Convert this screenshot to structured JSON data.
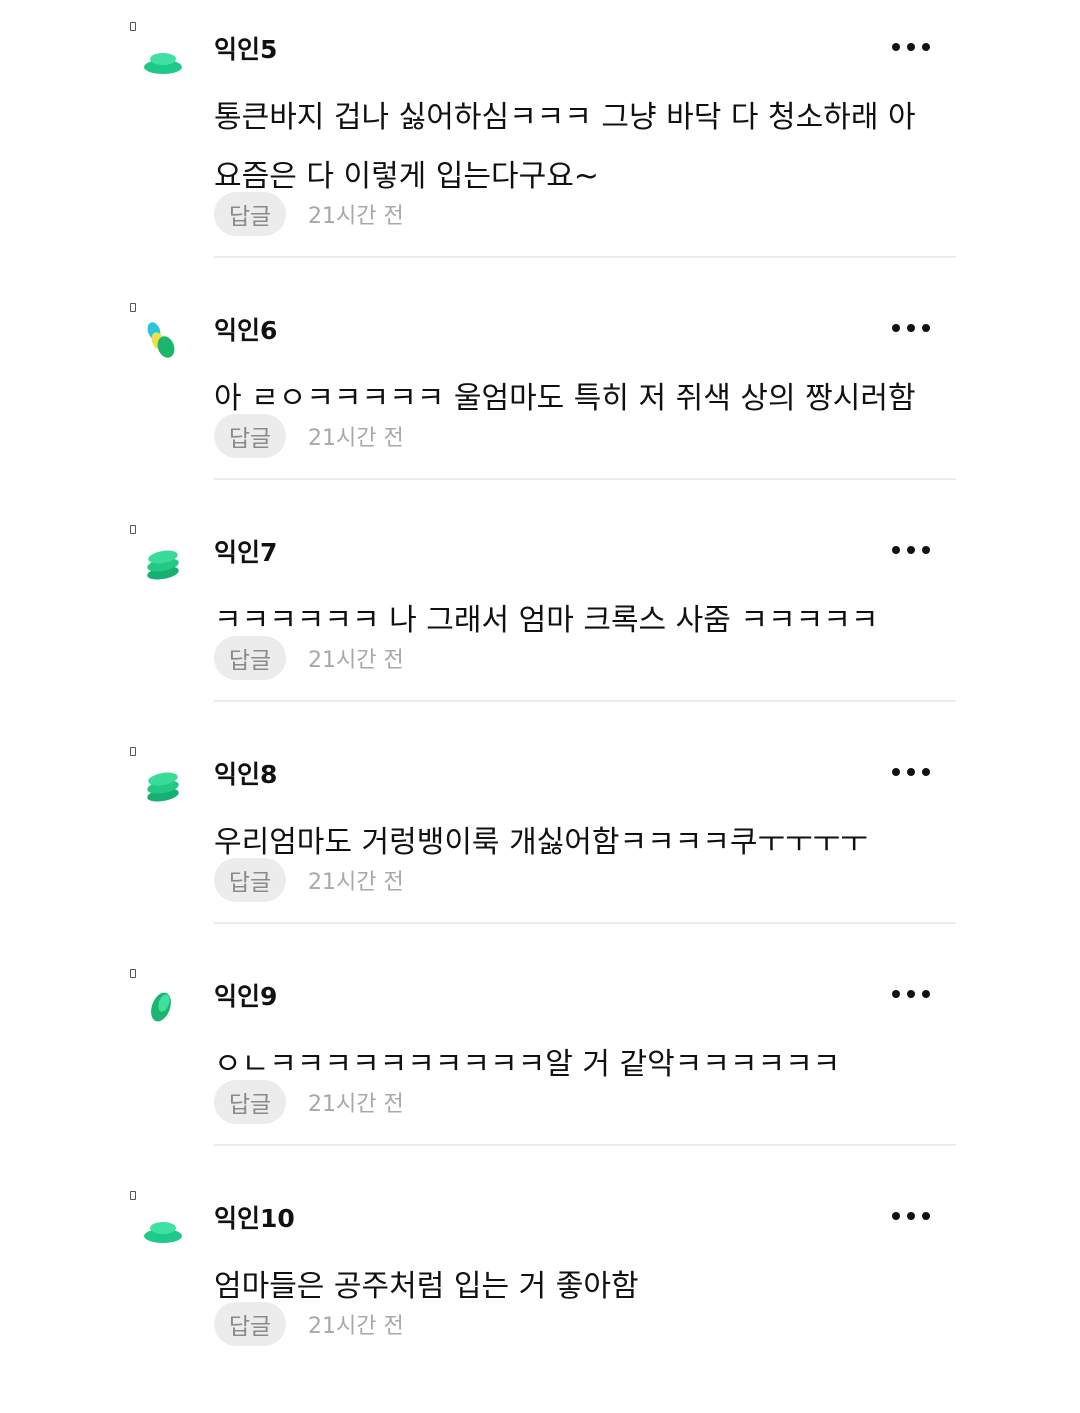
{
  "colors": {
    "avatar_primary": "#22cf8e",
    "avatar_secondary": "#1aa86f",
    "avatar_cyan": "#30c8e6",
    "avatar_yellow": "#f1e646",
    "reply_bg": "#ececec",
    "timestamp": "#a8a8a8"
  },
  "comments": [
    {
      "author": "익인5",
      "text": "통큰바지 겁나 싫어하심ㅋㅋㅋ 그냥 바닥 다 청소하래 아\n요즘은 다 이렇게 입는다구요~",
      "reply_label": "답글",
      "time": "21시간 전",
      "avatar_icon": "stacked-disc-avatar-icon"
    },
    {
      "author": "익인6",
      "text": "아 ㄹㅇㅋㅋㅋㅋㅋ 울엄마도 특히 저 쥐색 상의 짱시러함",
      "reply_label": "답글",
      "time": "21시간 전",
      "avatar_icon": "overlapping-ovals-avatar-icon"
    },
    {
      "author": "익인7",
      "text": "ㅋㅋㅋㅋㅋㅋ 나 그래서 엄마 크록스 사줌 ㅋㅋㅋㅋㅋ",
      "reply_label": "답글",
      "time": "21시간 전",
      "avatar_icon": "stacked-coins-avatar-icon"
    },
    {
      "author": "익인8",
      "text": "우리엄마도 거렁뱅이룩 개싫어함ㅋㅋㅋㅋ쿠ㅜㅜㅜㅜ",
      "reply_label": "답글",
      "time": "21시간 전",
      "avatar_icon": "stacked-coins-avatar-icon"
    },
    {
      "author": "익인9",
      "text": "ㅇㄴㅋㅋㅋㅋㅋㅋㅋㅋㅋㅋ알 거 같악ㅋㅋㅋㅋㅋㅋ",
      "reply_label": "답글",
      "time": "21시간 전",
      "avatar_icon": "tilted-oval-avatar-icon"
    },
    {
      "author": "익인10",
      "text": "엄마들은 공주처럼 입는 거 좋아함",
      "reply_label": "답글",
      "time": "21시간 전",
      "avatar_icon": "stacked-disc-avatar-icon"
    }
  ]
}
